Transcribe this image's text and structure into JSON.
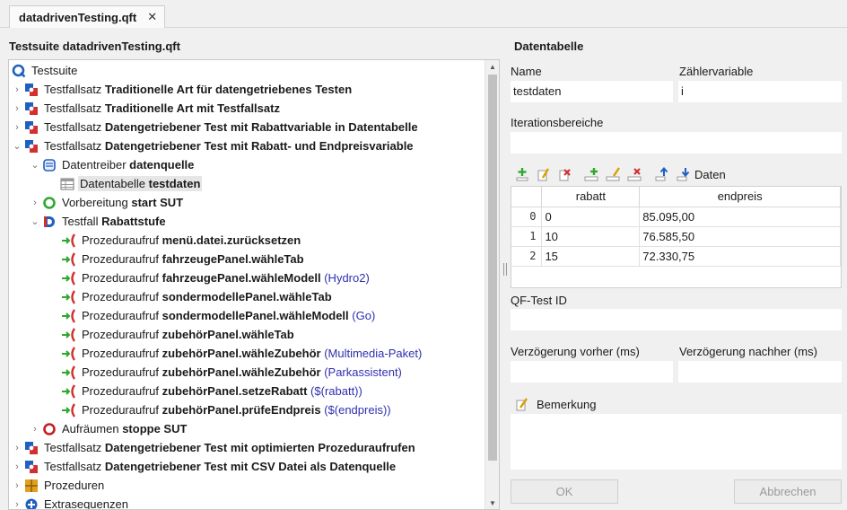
{
  "tab": {
    "title": "datadrivenTesting.qft",
    "close": "✕"
  },
  "left": {
    "title": "Testsuite datadrivenTesting.qft",
    "rows": [
      {
        "prefix": "Testsuite",
        "bold": "",
        "arg": ""
      },
      {
        "prefix": "Testfallsatz ",
        "bold": "Traditionelle Art für datengetriebenes Testen",
        "arg": ""
      },
      {
        "prefix": "Testfallsatz ",
        "bold": "Traditionelle Art mit Testfallsatz",
        "arg": ""
      },
      {
        "prefix": "Testfallsatz ",
        "bold": "Datengetriebener Test mit Rabattvariable in Datentabelle",
        "arg": ""
      },
      {
        "prefix": "Testfallsatz ",
        "bold": "Datengetriebener Test mit Rabatt- und Endpreisvariable",
        "arg": ""
      },
      {
        "prefix": "Datentreiber ",
        "bold": "datenquelle",
        "arg": ""
      },
      {
        "prefix": "Datentabelle ",
        "bold": "testdaten",
        "arg": ""
      },
      {
        "prefix": "Vorbereitung ",
        "bold": "start SUT",
        "arg": ""
      },
      {
        "prefix": "Testfall ",
        "bold": "Rabattstufe",
        "arg": ""
      },
      {
        "prefix": "Prozeduraufruf ",
        "bold": "menü.datei.zurücksetzen",
        "arg": ""
      },
      {
        "prefix": "Prozeduraufruf ",
        "bold": "fahrzeugePanel.wähleTab",
        "arg": ""
      },
      {
        "prefix": "Prozeduraufruf ",
        "bold": "fahrzeugePanel.wähleModell",
        "arg": " (Hydro2)"
      },
      {
        "prefix": "Prozeduraufruf ",
        "bold": "sondermodellePanel.wähleTab",
        "arg": ""
      },
      {
        "prefix": "Prozeduraufruf ",
        "bold": "sondermodellePanel.wähleModell",
        "arg": " (Go)"
      },
      {
        "prefix": "Prozeduraufruf ",
        "bold": "zubehörPanel.wähleTab",
        "arg": ""
      },
      {
        "prefix": "Prozeduraufruf ",
        "bold": "zubehörPanel.wähleZubehör",
        "arg": " (Multimedia-Paket)"
      },
      {
        "prefix": "Prozeduraufruf ",
        "bold": "zubehörPanel.wähleZubehör",
        "arg": " (Parkassistent)"
      },
      {
        "prefix": "Prozeduraufruf ",
        "bold": "zubehörPanel.setzeRabatt",
        "arg": " ($(rabatt))"
      },
      {
        "prefix": "Prozeduraufruf ",
        "bold": "zubehörPanel.prüfeEndpreis",
        "arg": " ($(endpreis))"
      },
      {
        "prefix": "Aufräumen ",
        "bold": "stoppe SUT",
        "arg": ""
      },
      {
        "prefix": "Testfallsatz ",
        "bold": "Datengetriebener Test mit optimierten Prozeduraufrufen",
        "arg": ""
      },
      {
        "prefix": "Testfallsatz ",
        "bold": "Datengetriebener Test mit CSV Datei als Datenquelle",
        "arg": ""
      },
      {
        "prefix": "Prozeduren",
        "bold": "",
        "arg": ""
      },
      {
        "prefix": "Extrasequenzen",
        "bold": "",
        "arg": ""
      }
    ]
  },
  "right": {
    "title": "Datentabelle",
    "name_label": "Name",
    "name_value": "testdaten",
    "counter_label": "Zählervariable",
    "counter_value": "i",
    "iter_label": "Iterationsbereiche",
    "iter_value": "",
    "data_label": "Daten",
    "table": {
      "headers": [
        "",
        "rabatt",
        "endpreis"
      ],
      "rows": [
        [
          "0",
          "0",
          "85.095,00"
        ],
        [
          "1",
          "10",
          "76.585,50"
        ],
        [
          "2",
          "15",
          "72.330,75"
        ]
      ]
    },
    "qfid_label": "QF-Test ID",
    "qfid_value": "",
    "delay_before_label": "Verzögerung vorher (ms)",
    "delay_before_value": "",
    "delay_after_label": "Verzögerung nachher (ms)",
    "delay_after_value": "",
    "comment_label": "Bemerkung",
    "comment_value": "",
    "ok_label": "OK",
    "cancel_label": "Abbrechen"
  },
  "colors": {
    "accent_blue": "#1f5fbf",
    "add_green": "#2fa82f",
    "delete_red": "#d23030",
    "arg_blue": "#2f2fb0"
  }
}
